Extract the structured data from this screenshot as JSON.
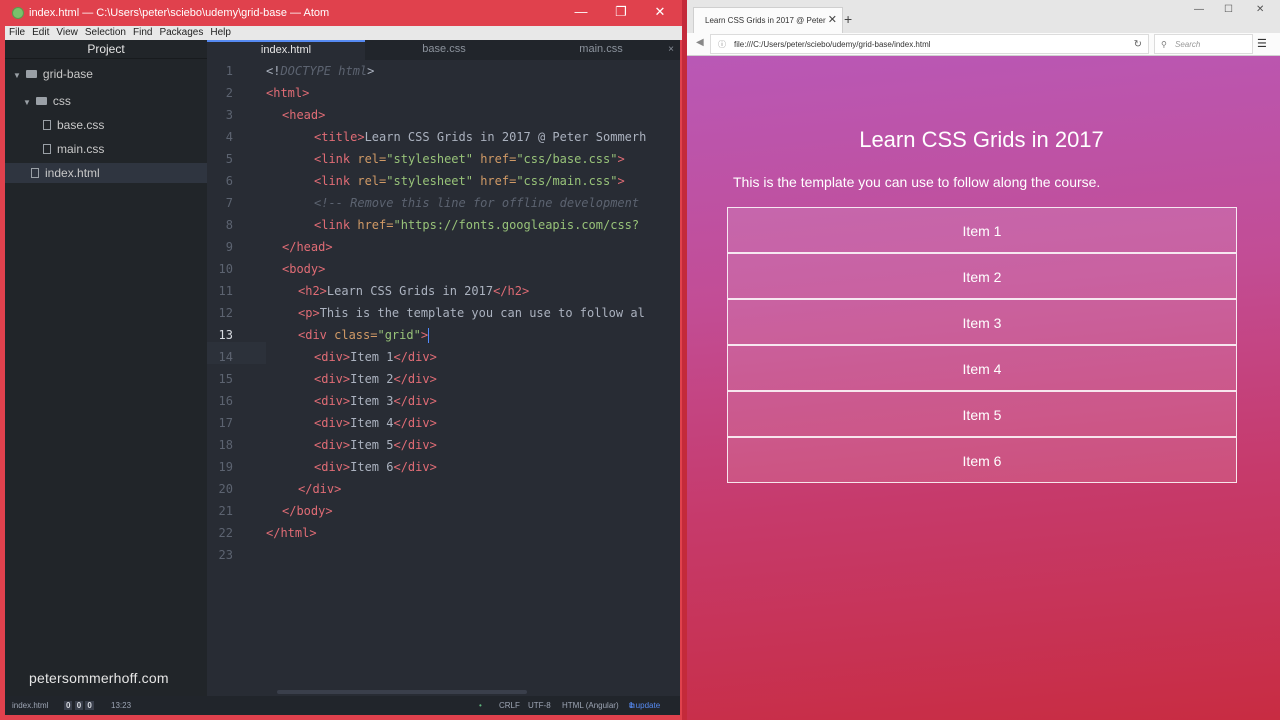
{
  "atom": {
    "window_title": "index.html — C:\\Users\\peter\\sciebo\\udemy\\grid-base — Atom",
    "window_controls": [
      "—",
      "❐",
      "✕"
    ],
    "menu": [
      "File",
      "Edit",
      "View",
      "Selection",
      "Find",
      "Packages",
      "Help"
    ],
    "tree": {
      "header": "Project",
      "root": "grid-base",
      "folder": "css",
      "files_in_folder": [
        "base.css",
        "main.css"
      ],
      "root_file": "index.html",
      "branding": "petersommerhoff.com"
    },
    "tabs": [
      {
        "label": "index.html",
        "active": true
      },
      {
        "label": "base.css",
        "active": false
      },
      {
        "label": "main.css",
        "active": false
      }
    ],
    "tab_close": "×",
    "line_numbers": [
      "1",
      "2",
      "3",
      "4",
      "5",
      "6",
      "7",
      "8",
      "9",
      "10",
      "11",
      "12",
      "13",
      "14",
      "15",
      "16",
      "17",
      "18",
      "19",
      "20",
      "21",
      "22",
      "23"
    ],
    "current_line": "13",
    "code": {
      "l1": {
        "open": "<!",
        "doctype": "DOCTYPE html",
        "close": ">"
      },
      "l2": "<html>",
      "l3": "<head>",
      "l4": {
        "tag": "<title>",
        "text": "Learn CSS Grids in 2017 @ Peter Sommerh"
      },
      "l5": {
        "tag": "<link ",
        "a1": "rel=",
        "v1": "\"stylesheet\"",
        "a2": " href=",
        "v2": "\"css/base.css\"",
        "end": ">"
      },
      "l6": {
        "tag": "<link ",
        "a1": "rel=",
        "v1": "\"stylesheet\"",
        "a2": " href=",
        "v2": "\"css/main.css\"",
        "end": ">"
      },
      "l7": "<!-- Remove this line for offline development",
      "l8": {
        "tag": "<link ",
        "a1": "href=",
        "v1": "\"https://fonts.googleapis.com/css?"
      },
      "l9": "</head>",
      "l10": "<body>",
      "l11": {
        "open": "<h2>",
        "text": "Learn CSS Grids in 2017",
        "close": "</h2>"
      },
      "l12": {
        "open": "<p>",
        "text": "This is the template you can use to follow al"
      },
      "l13": {
        "tag": "<div ",
        "a1": "class=",
        "v1": "\"grid\"",
        "end": ">"
      },
      "items": [
        "Item 1",
        "Item 2",
        "Item 3",
        "Item 4",
        "Item 5",
        "Item 6"
      ],
      "div_open": "<div>",
      "div_close": "</div>",
      "l20": "</div>",
      "l21": "</body>",
      "l22": "</html>"
    },
    "status": {
      "file": "index.html",
      "counts": [
        "0",
        "0",
        "0"
      ],
      "cursor": "13:23",
      "line_ending": "CRLF",
      "encoding": "UTF-8",
      "grammar": "HTML (Angular)",
      "updates": "1 update"
    }
  },
  "firefox": {
    "tab_title": "Learn CSS Grids in 2017 @ Peter",
    "tab_close": "✕",
    "new_tab": "+",
    "window_controls": [
      "—",
      "☐",
      "✕"
    ],
    "url": "file:///C:/Users/peter/sciebo/udemy/grid-base/index.html",
    "search_placeholder": "Search",
    "page": {
      "heading": "Learn CSS Grids in 2017",
      "paragraph": "This is the template you can use to follow along the course.",
      "items": [
        "Item 1",
        "Item 2",
        "Item 3",
        "Item 4",
        "Item 5",
        "Item 6"
      ]
    }
  },
  "colors": {
    "atom_frame": "#e0414d",
    "editor_bg": "#282c34",
    "tag": "#e06c75",
    "attribute": "#d19a66",
    "string": "#98c379",
    "page_gradient_top": "#b958b6",
    "page_gradient_bottom": "#c82c42"
  }
}
